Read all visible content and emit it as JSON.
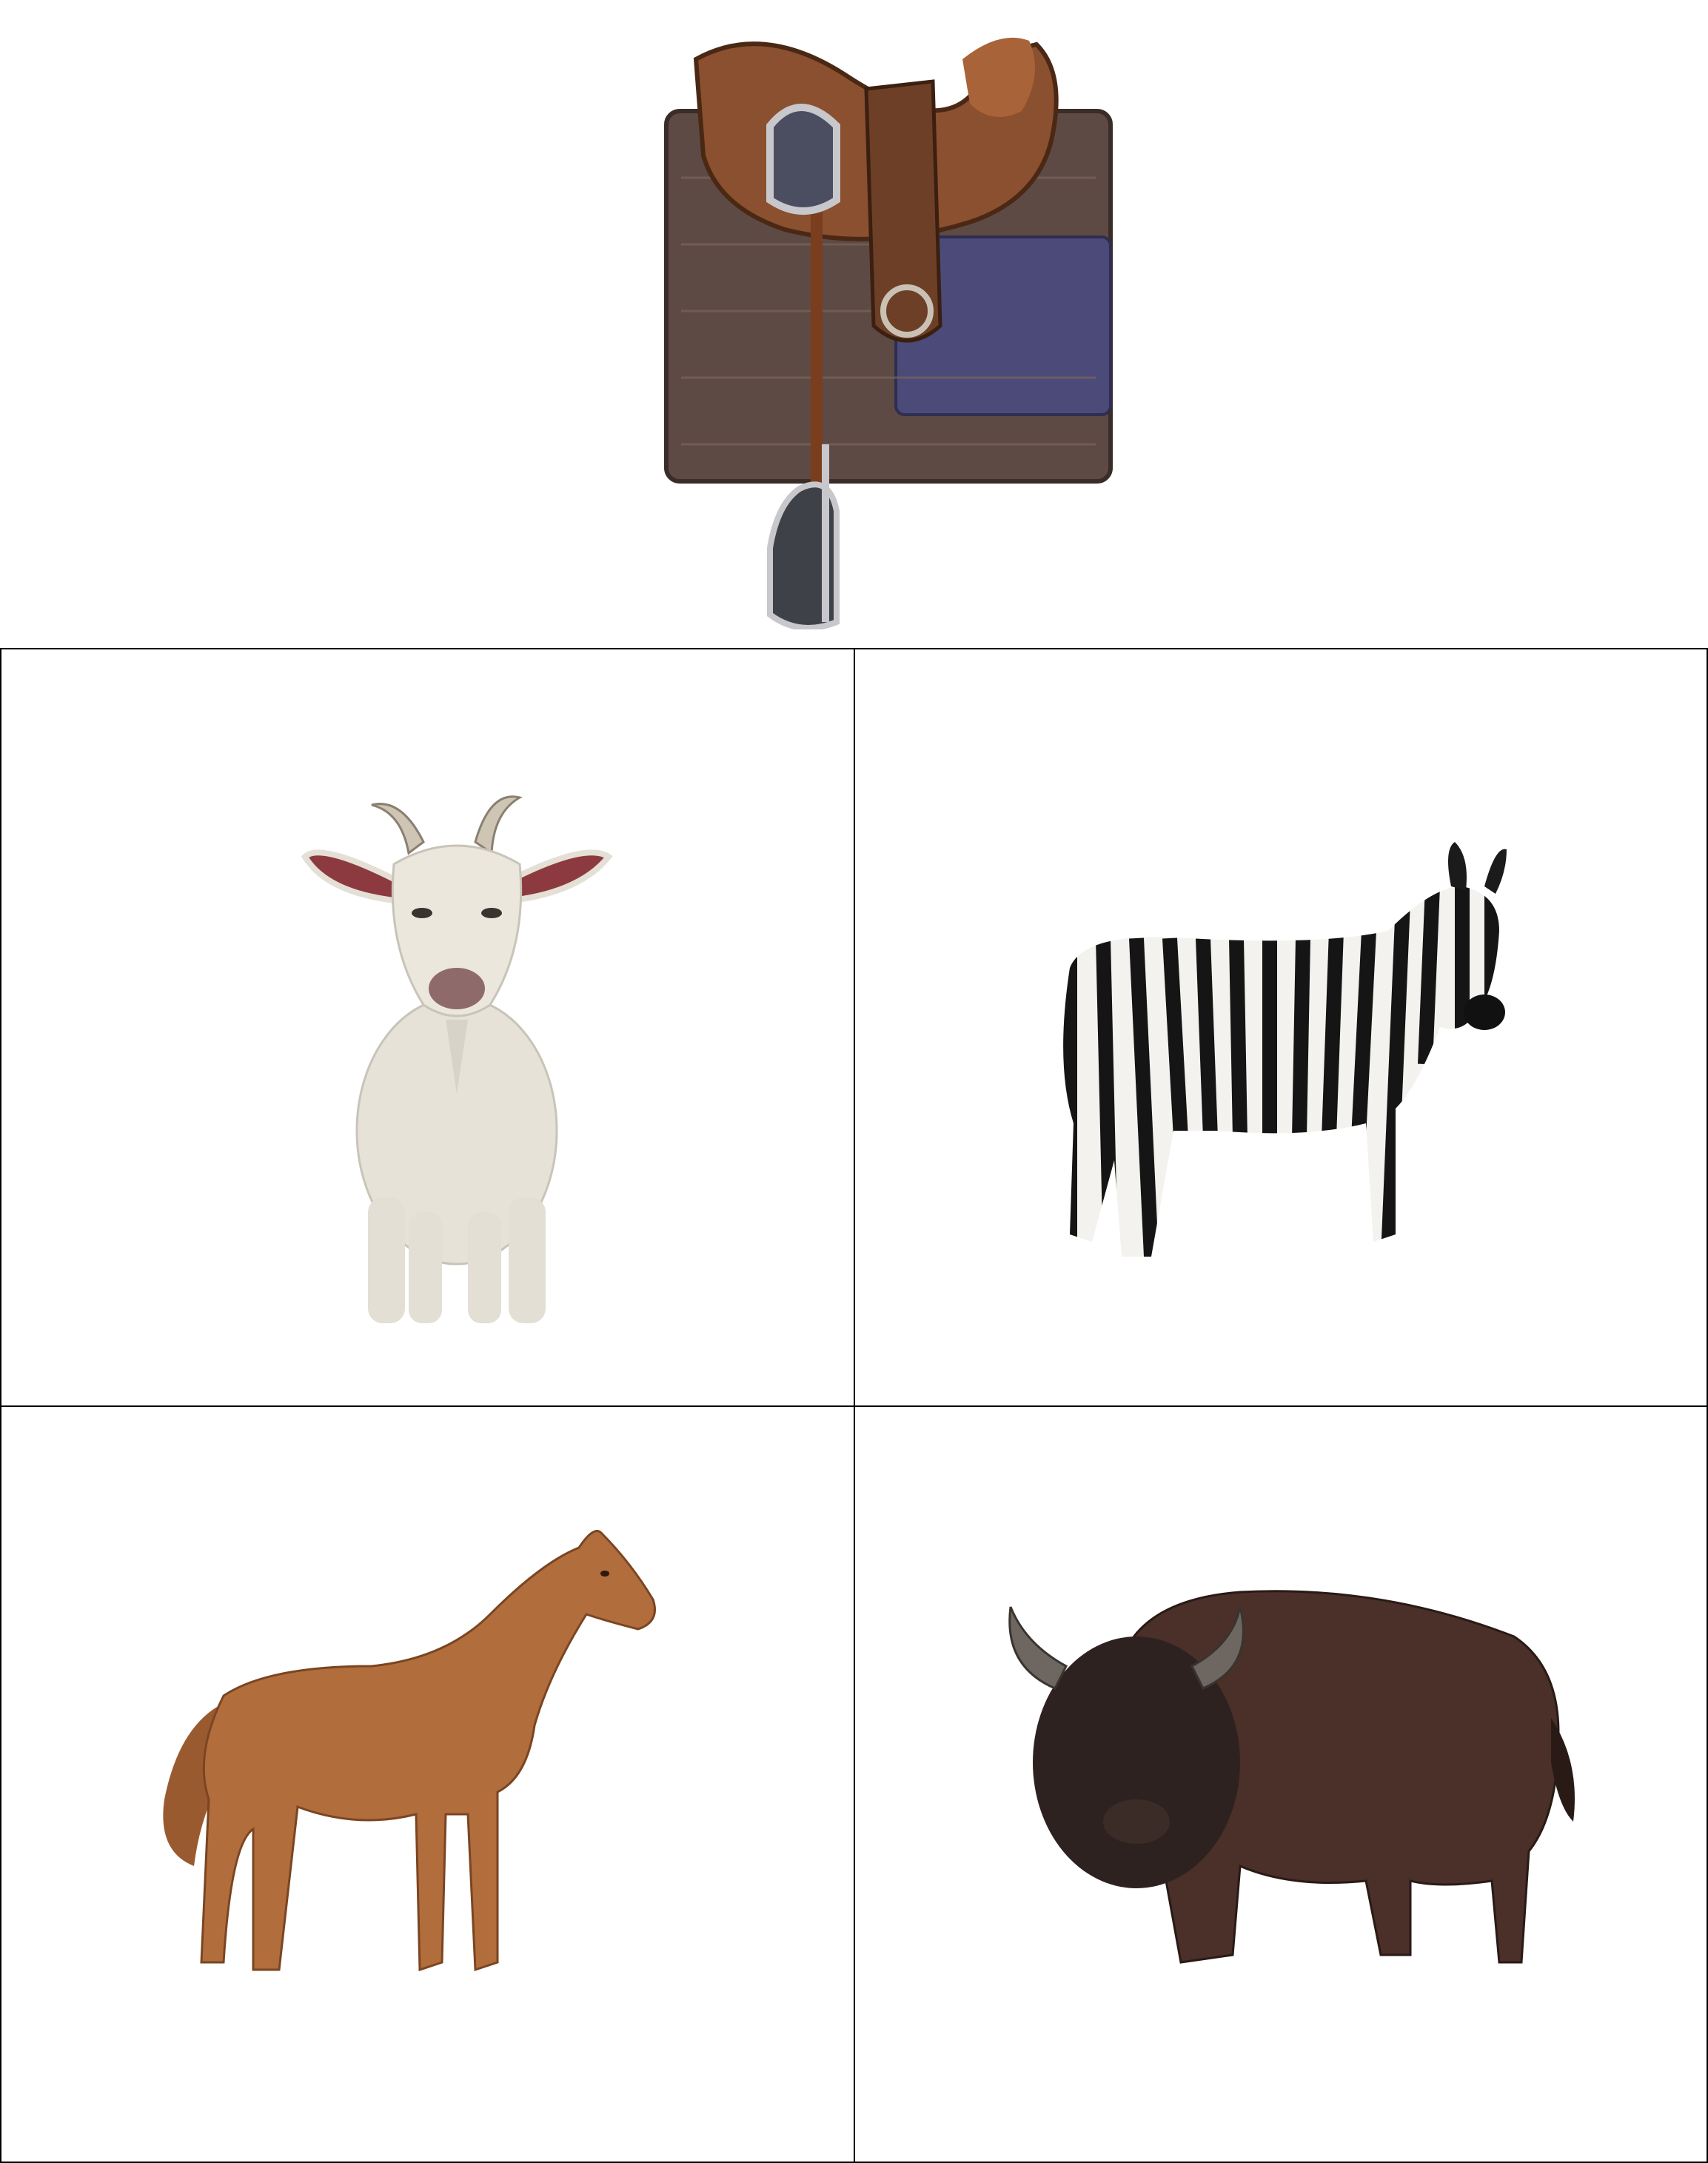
{
  "prompt": {
    "image": "western-saddle-with-stirrup-and-blanket"
  },
  "choices": [
    {
      "image": "white-goat-standing-front-view"
    },
    {
      "image": "zebra-standing-side-view"
    },
    {
      "image": "chestnut-horse-standing-side-view"
    },
    {
      "image": "american-bison-standing"
    }
  ],
  "colors": {
    "background": "#ffffff",
    "grid_border": "#000000",
    "saddle_leather": "#8a5030",
    "saddle_pad": "#5e4a44",
    "goat": "#e6e2d8",
    "horse": "#b26d3c",
    "bison": "#3e2a24"
  }
}
